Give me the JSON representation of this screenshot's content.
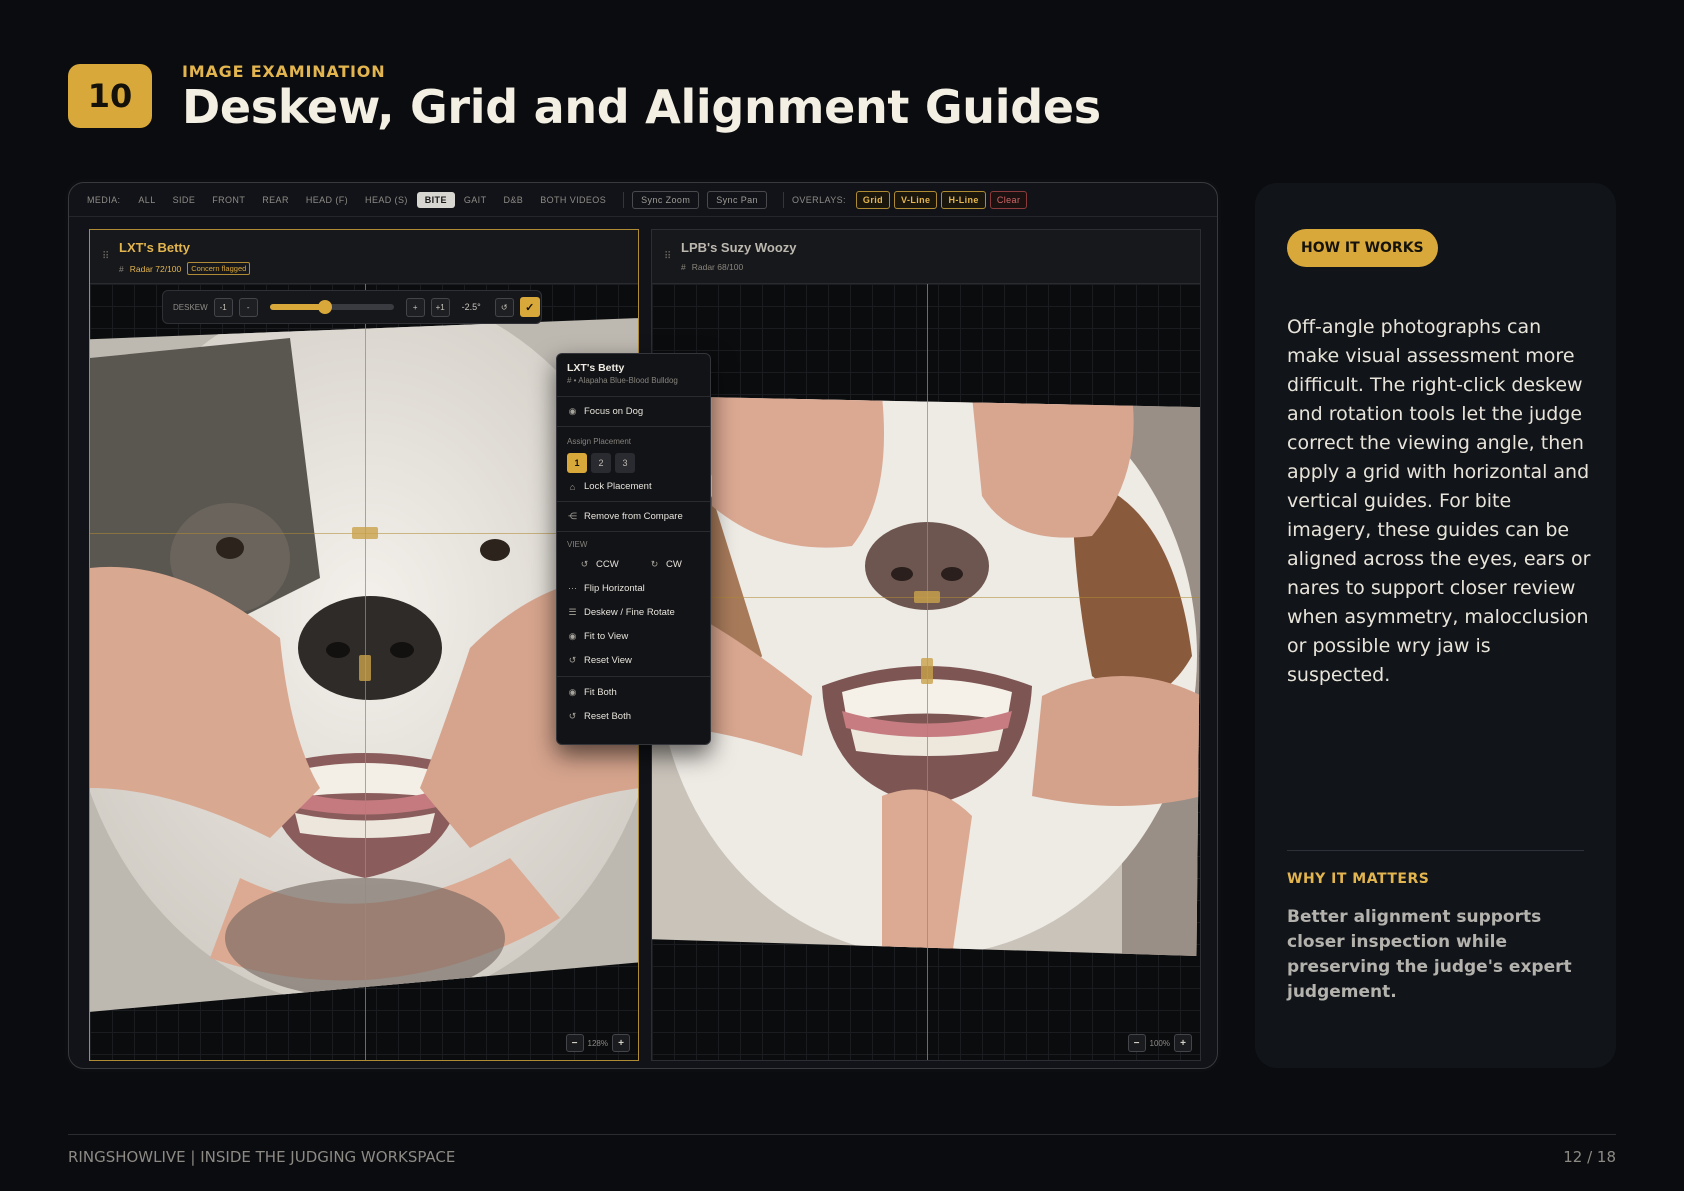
{
  "header": {
    "slide_number": "10",
    "eyebrow": "IMAGE EXAMINATION",
    "title": "Deskew, Grid and Alignment Guides"
  },
  "toolbar": {
    "media_label": "MEDIA:",
    "media_tabs": [
      "ALL",
      "SIDE",
      "FRONT",
      "REAR",
      "HEAD (F)",
      "HEAD (S)",
      "BITE",
      "GAIT",
      "D&B",
      "BOTH VIDEOS"
    ],
    "active_tab": "BITE",
    "sync_zoom": "Sync Zoom",
    "sync_pan": "Sync Pan",
    "overlays_label": "OVERLAYS:",
    "overlays": [
      "Grid",
      "V-Line",
      "H-Line"
    ],
    "clear": "Clear"
  },
  "left_panel": {
    "name": "LXT's Betty",
    "hash": "#",
    "radar": "Radar 72/100",
    "flag": "Concern flagged",
    "zoom": "128%"
  },
  "right_panel": {
    "name": "LPB's Suzy Woozy",
    "hash": "#",
    "radar": "Radar 68/100",
    "zoom": "100%"
  },
  "deskew": {
    "label": "DESKEW",
    "minus_one": "-1",
    "minus": "-",
    "plus": "+",
    "plus_one": "+1",
    "value": "-2.5°",
    "slider_fraction": 0.45
  },
  "context_menu": {
    "title": "LXT's Betty",
    "subtitle": "# • Alapaha Blue-Blood Bulldog",
    "focus": "Focus on Dog",
    "assign_label": "Assign Placement",
    "placements": [
      "1",
      "2",
      "3"
    ],
    "lock": "Lock Placement",
    "remove": "Remove from Compare",
    "view_label": "VIEW",
    "ccw": "CCW",
    "cw": "CW",
    "flip": "Flip Horizontal",
    "deskew": "Deskew / Fine Rotate",
    "fit_view": "Fit to View",
    "reset_view": "Reset View",
    "fit_both": "Fit Both",
    "reset_both": "Reset Both"
  },
  "sidebar": {
    "pill": "HOW IT WORKS",
    "body": "Off-angle photographs can make visual assessment more difficult. The right-click deskew and rotation tools let the judge correct the viewing angle, then apply a grid with horizontal and vertical guides. For bite imagery, these guides can be aligned across the eyes, ears or nares to support closer review when asymmetry, malocclusion or possible wry jaw is suspected.",
    "why_title": "WHY IT MATTERS",
    "why_text": "Better alignment supports closer inspection while preserving the judge's expert judgement."
  },
  "footer": {
    "left": "RINGSHOWLIVE | INSIDE THE JUDGING WORKSPACE",
    "right": "12 / 18"
  },
  "colors": {
    "accent": "#d9a83a",
    "background": "#0a0c10",
    "danger": "#d06666"
  }
}
